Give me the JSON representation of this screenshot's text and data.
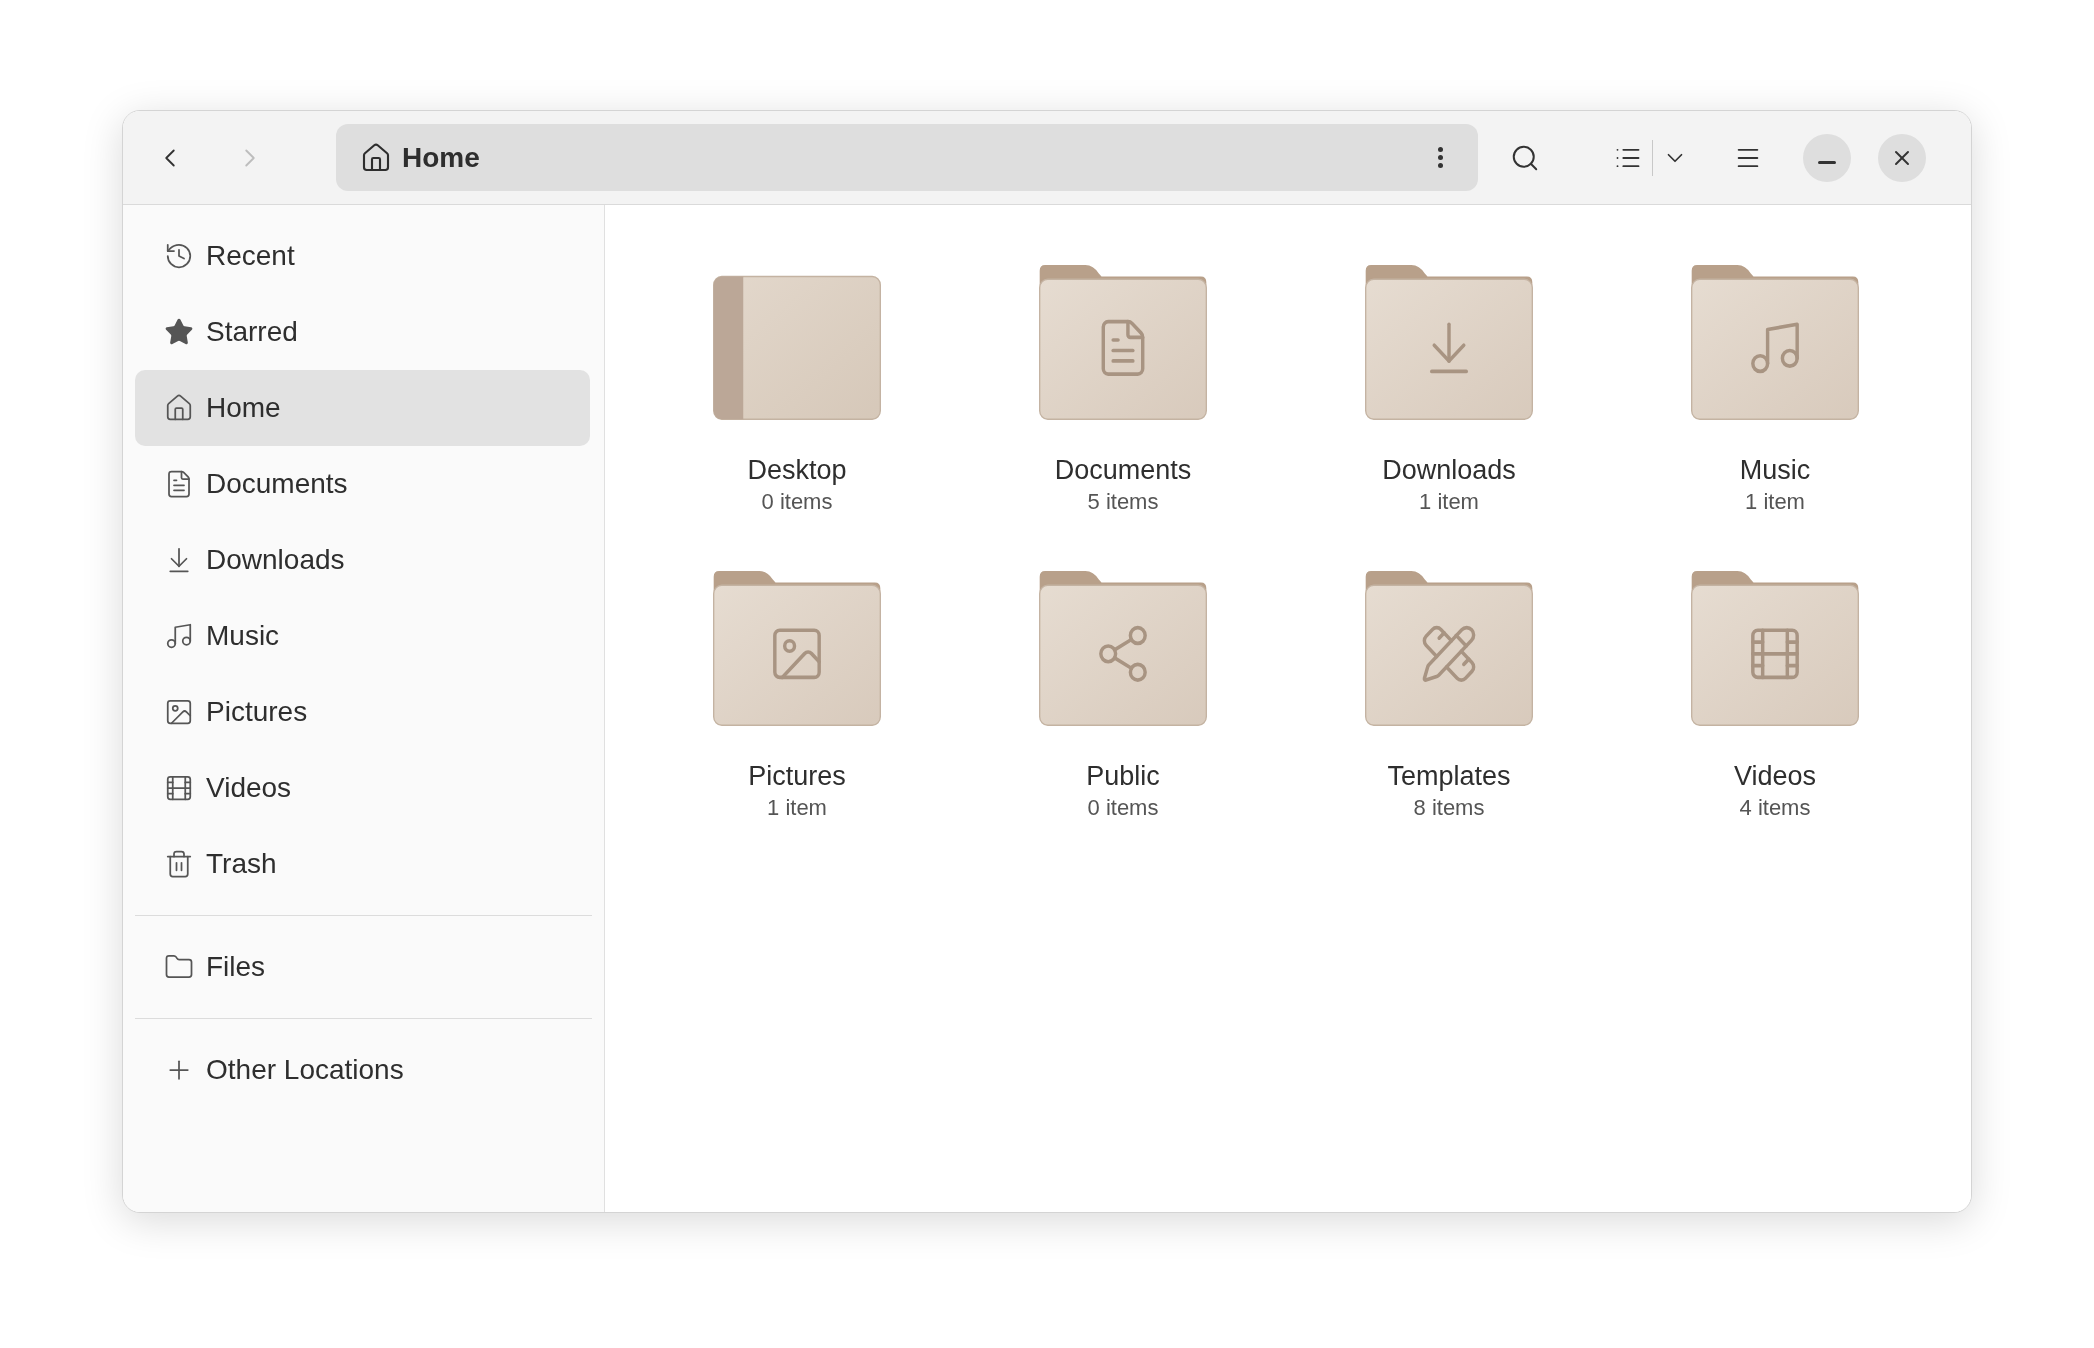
{
  "header": {
    "back": {
      "disabled": false
    },
    "forward": {
      "disabled": true
    },
    "path": {
      "label": "Home"
    }
  },
  "sidebar": {
    "groups": [
      {
        "items": [
          {
            "label": "Recent",
            "kind": "recent",
            "selected": false
          },
          {
            "label": "Starred",
            "kind": "starred",
            "selected": false
          },
          {
            "label": "Home",
            "kind": "home",
            "selected": true
          },
          {
            "label": "Documents",
            "kind": "documents",
            "selected": false
          },
          {
            "label": "Downloads",
            "kind": "downloads",
            "selected": false
          },
          {
            "label": "Music",
            "kind": "music",
            "selected": false
          },
          {
            "label": "Pictures",
            "kind": "pictures",
            "selected": false
          },
          {
            "label": "Videos",
            "kind": "videos",
            "selected": false
          },
          {
            "label": "Trash",
            "kind": "trash",
            "selected": false
          }
        ]
      },
      {
        "items": [
          {
            "label": "Files",
            "kind": "folder",
            "selected": false
          }
        ]
      },
      {
        "items": [
          {
            "label": "Other Locations",
            "kind": "add",
            "selected": false
          }
        ]
      }
    ]
  },
  "folders": [
    {
      "name": "Desktop",
      "count": "0 items",
      "kind": "desktop"
    },
    {
      "name": "Documents",
      "count": "5 items",
      "kind": "documents"
    },
    {
      "name": "Downloads",
      "count": "1 item",
      "kind": "downloads"
    },
    {
      "name": "Music",
      "count": "1 item",
      "kind": "music"
    },
    {
      "name": "Pictures",
      "count": "1 item",
      "kind": "pictures"
    },
    {
      "name": "Public",
      "count": "0 items",
      "kind": "public"
    },
    {
      "name": "Templates",
      "count": "8 items",
      "kind": "templates"
    },
    {
      "name": "Videos",
      "count": "4 items",
      "kind": "videos"
    }
  ]
}
